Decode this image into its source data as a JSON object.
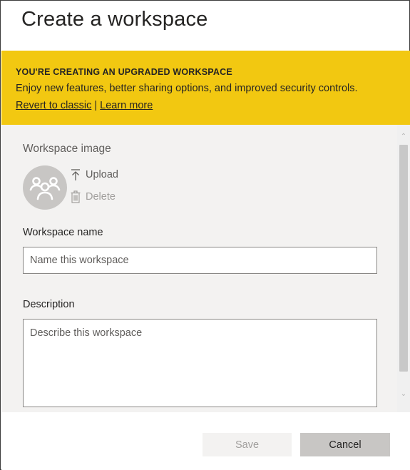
{
  "dialog": {
    "title": "Create a workspace"
  },
  "banner": {
    "heading": "YOU'RE CREATING AN UPGRADED WORKSPACE",
    "text": "Enjoy new features, better sharing options, and improved security controls.",
    "revert_link": "Revert to classic",
    "separator": "|",
    "learn_more_link": "Learn more",
    "background_color": "#f2c811"
  },
  "workspace_image": {
    "label": "Workspace image",
    "upload_label": "Upload",
    "delete_label": "Delete",
    "avatar_icon": "people-group-icon",
    "upload_icon": "upload-icon",
    "delete_icon": "trash-icon"
  },
  "workspace_name": {
    "label": "Workspace name",
    "value": "",
    "placeholder": "Name this workspace"
  },
  "description": {
    "label": "Description",
    "value": "",
    "placeholder": "Describe this workspace"
  },
  "footer": {
    "save_label": "Save",
    "cancel_label": "Cancel",
    "save_enabled": false
  }
}
